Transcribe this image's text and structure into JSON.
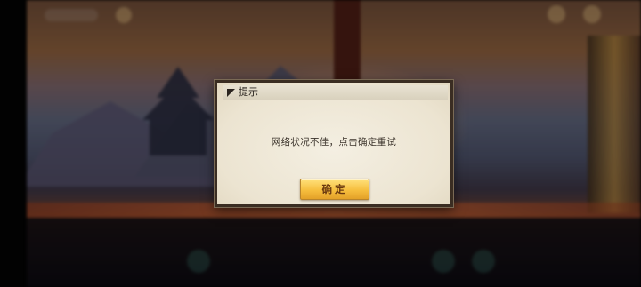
{
  "dialog": {
    "title": "提示",
    "message": "网络状况不佳，点击确定重试",
    "confirm_label": "确定"
  },
  "colors": {
    "dialog_background": "#efe8d8",
    "dialog_border": "#3a2d22",
    "button_gold": "#f6be3e",
    "button_text": "#6b3a10"
  },
  "icons": {
    "title_marker": "corner-triangle-icon"
  }
}
